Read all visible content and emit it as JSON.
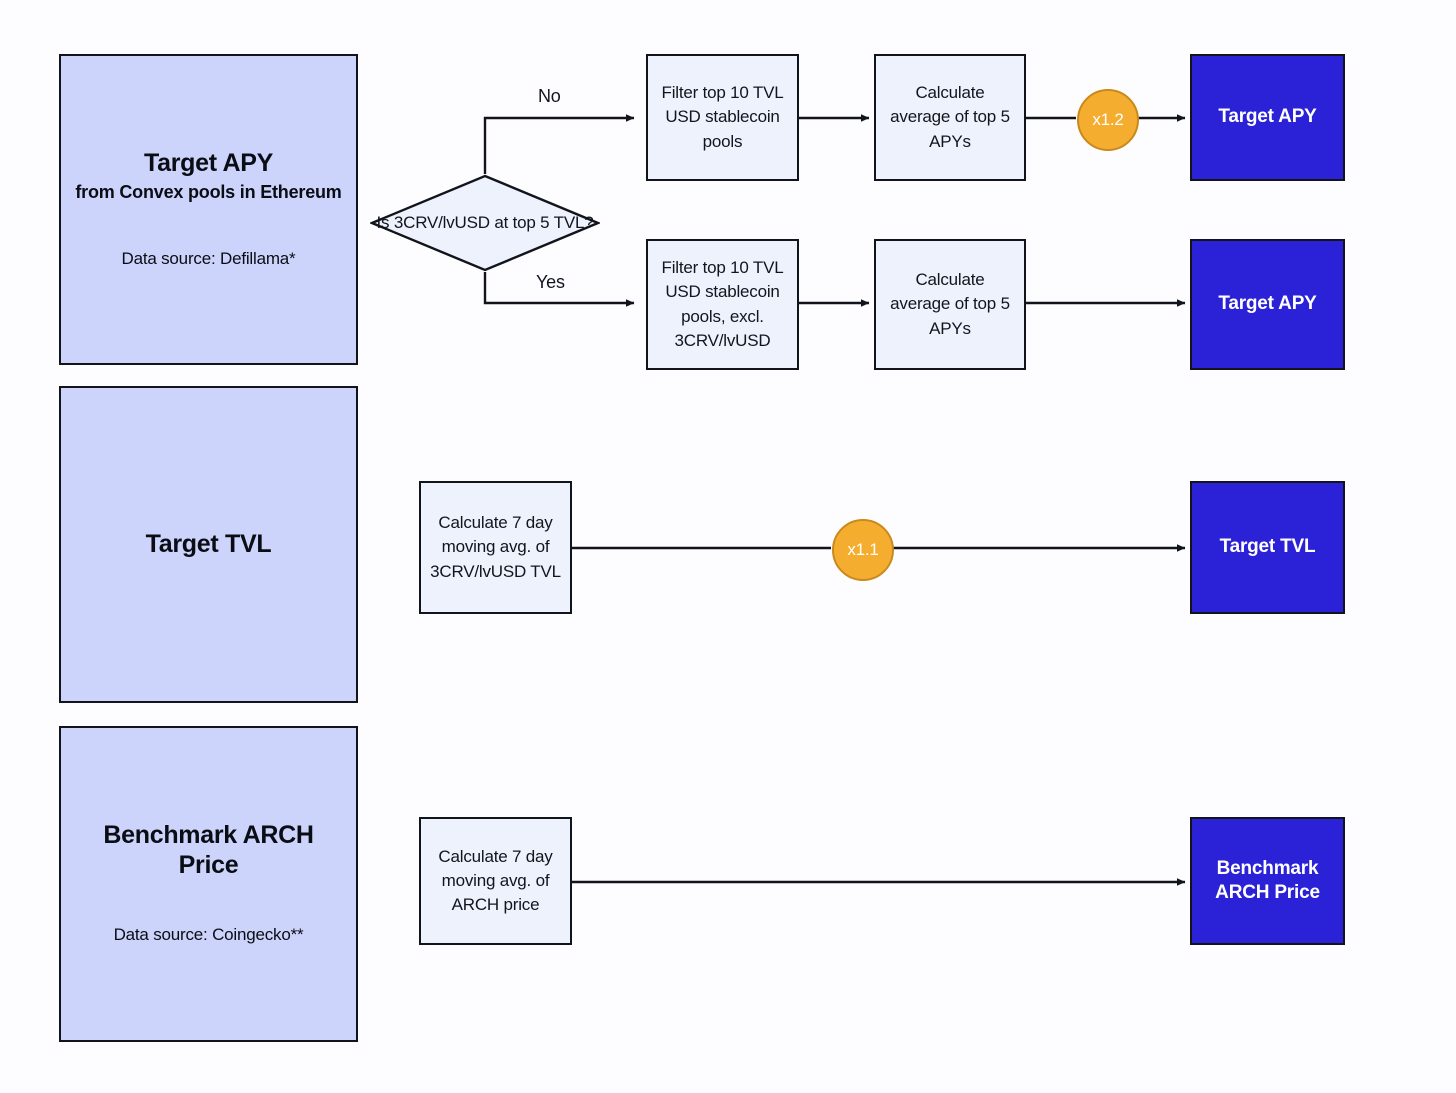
{
  "diagram": {
    "title": "Target metric calculation flowchart",
    "background_color": "#fdfdff",
    "colors": {
      "panel_fill": "#ccd4fb",
      "process_fill": "#eef2fc",
      "result_fill": "#2b22d8",
      "multiplier_fill": "#f5ad30",
      "stroke": "#12141c",
      "result_text": "#ffffff"
    }
  },
  "rows": {
    "apy": {
      "panel": {
        "title": "Target APY",
        "subtitle": "from Convex pools in Ethereum",
        "source": "Data source: Defillama*"
      },
      "decision": {
        "text": "Is 3CRV/lvUSD at top 5 TVL?",
        "branch_no": "No",
        "branch_yes": "Yes"
      },
      "branch_no": {
        "filter": "Filter top 10 TVL USD stablecoin pools",
        "average": "Calculate average of top 5 APYs",
        "multiplier": "x1.2",
        "result": "Target APY"
      },
      "branch_yes": {
        "filter": "Filter top 10 TVL USD stablecoin pools, excl. 3CRV/lvUSD",
        "average": "Calculate average of top 5 APYs",
        "result": "Target APY"
      }
    },
    "tvl": {
      "panel": {
        "title": "Target TVL"
      },
      "process": "Calculate 7 day moving avg. of 3CRV/lvUSD TVL",
      "multiplier": "x1.1",
      "result": "Target TVL"
    },
    "arch": {
      "panel": {
        "title": "Benchmark ARCH Price",
        "source": "Data source: Coingecko**"
      },
      "process": "Calculate 7 day moving avg. of ARCH price",
      "result": "Benchmark ARCH Price"
    }
  }
}
